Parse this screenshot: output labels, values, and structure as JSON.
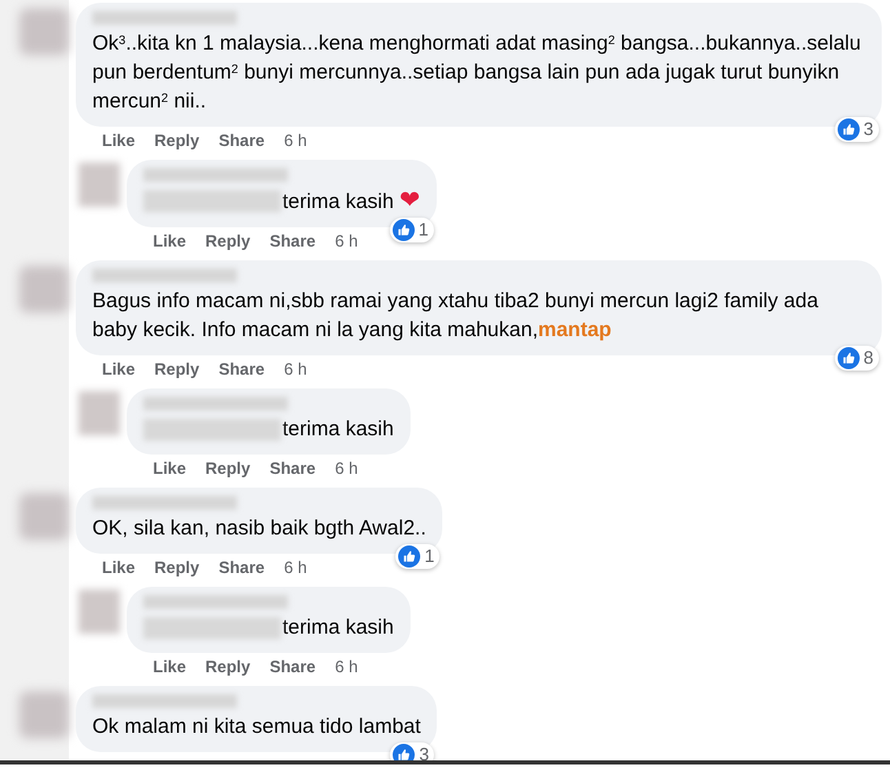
{
  "comments": [
    {
      "kind": "comment",
      "redacted_name": true,
      "text": "Ok$^{3}$..kita kn 1 malaysia...kena menghormati adat masing$^{2}$ bangsa...bukannya..selalu pun berdentum$^{2}$ bunyi mercunnya..setiap bangsa lain pun ada jugak turut bunyikn mercun$^{2}$ nii..",
      "reaction": {
        "count": "3"
      },
      "actions": [
        "Like",
        "Reply",
        "Share"
      ],
      "time": "6 h"
    },
    {
      "kind": "reply",
      "redacted_name": true,
      "redacted_mention": true,
      "text": "terima kasih",
      "emoji": "❤",
      "reaction": {
        "count": "1"
      },
      "actions": [
        "Like",
        "Reply",
        "Share"
      ],
      "time": "6 h"
    },
    {
      "kind": "comment",
      "redacted_name": true,
      "text": "Bagus info macam ni,sbb ramai yang xtahu tiba2 bunyi mercun lagi2 family ada baby kecik. Info macam ni la yang kita mahukan,**mantap**",
      "reaction": {
        "count": "8"
      },
      "actions": [
        "Like",
        "Reply",
        "Share"
      ],
      "time": "6 h"
    },
    {
      "kind": "reply",
      "redacted_name": true,
      "redacted_mention": true,
      "text": "terima kasih",
      "actions": [
        "Like",
        "Reply",
        "Share"
      ],
      "time": "6 h"
    },
    {
      "kind": "comment",
      "redacted_name": true,
      "text": "OK, sila kan, nasib baik bgth Awal2..",
      "reaction": {
        "count": "1"
      },
      "actions": [
        "Like",
        "Reply",
        "Share"
      ],
      "time": "6 h"
    },
    {
      "kind": "reply",
      "redacted_name": true,
      "redacted_mention": true,
      "text": "terima kasih",
      "actions": [
        "Like",
        "Reply",
        "Share"
      ],
      "time": "6 h"
    },
    {
      "kind": "comment",
      "redacted_name": true,
      "text": "Ok malam ni kita semua tido lambat",
      "reaction": {
        "count": "3"
      }
    }
  ]
}
